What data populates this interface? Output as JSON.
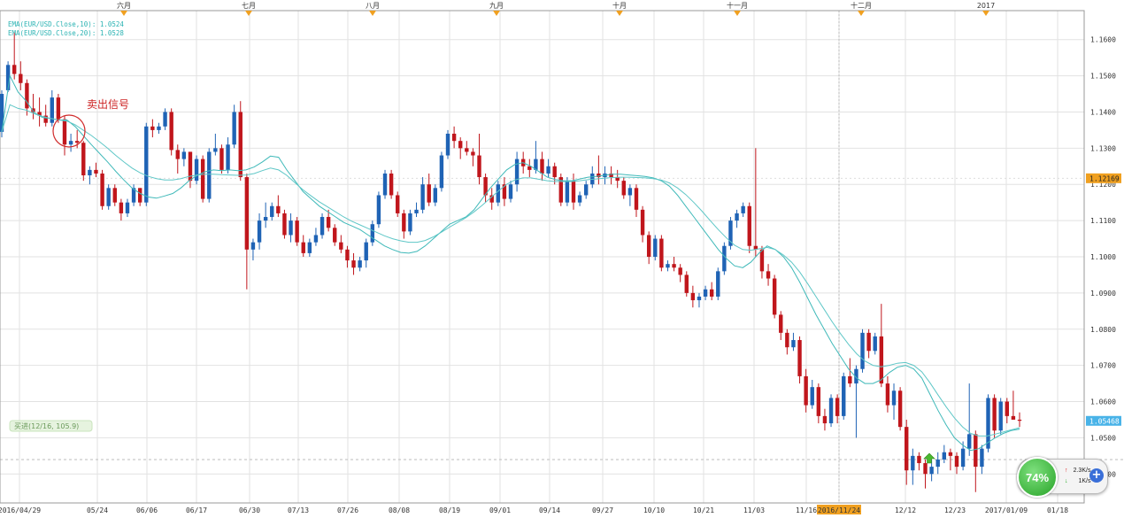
{
  "chart_data": {
    "type": "candlestick",
    "title": "",
    "xlabel": "",
    "ylabel": "",
    "ylim": [
      1.032,
      1.168
    ],
    "y_ticks": [
      "1.1600",
      "1.1500",
      "1.1400",
      "1.1300",
      "1.1200",
      "1.1100",
      "1.1000",
      "1.0900",
      "1.0800",
      "1.0700",
      "1.0600",
      "1.0500",
      "1.0400"
    ],
    "x_ticks": [
      "2016/04/29",
      "05/24",
      "06/06",
      "06/17",
      "06/30",
      "07/13",
      "07/26",
      "08/08",
      "08/19",
      "09/01",
      "09/14",
      "09/27",
      "10/10",
      "10/21",
      "11/03",
      "11/16",
      "2016/11/24",
      "12/12",
      "12/23",
      "2017/01/09",
      "01/18"
    ],
    "month_labels": [
      "六月",
      "七月",
      "八月",
      "九月",
      "十月",
      "十一月",
      "十二月",
      "2017"
    ],
    "legend": [
      "EMA(EUR/USD.Close,10): 1.0524",
      "EMA(EUR/USD.Close,20): 1.0528"
    ],
    "price_tags": {
      "upper": "1.12169",
      "current": "1.05468"
    },
    "annotations": {
      "sell": "卖出信号",
      "buy": "买进(12/16, 105.9)"
    },
    "colors": {
      "up": "#1f63b5",
      "down": "#c0161c",
      "ema10": "#3fb9b9",
      "ema20": "#5fc7c7",
      "grid": "#e2e2e2",
      "month_marker": "#f0a020"
    },
    "ohlc": [
      [
        1.1345,
        1.146,
        1.133,
        1.145
      ],
      [
        1.146,
        1.154,
        1.1455,
        1.153
      ],
      [
        1.153,
        1.162,
        1.149,
        1.1505
      ],
      [
        1.1505,
        1.154,
        1.146,
        1.148
      ],
      [
        1.148,
        1.149,
        1.139,
        1.141
      ],
      [
        1.141,
        1.145,
        1.138,
        1.14
      ],
      [
        1.14,
        1.144,
        1.136,
        1.139
      ],
      [
        1.139,
        1.142,
        1.136,
        1.137
      ],
      [
        1.137,
        1.146,
        1.136,
        1.144
      ],
      [
        1.144,
        1.145,
        1.137,
        1.138
      ],
      [
        1.138,
        1.139,
        1.128,
        1.131
      ],
      [
        1.131,
        1.134,
        1.129,
        1.132
      ],
      [
        1.132,
        1.135,
        1.13,
        1.1315
      ],
      [
        1.1315,
        1.132,
        1.121,
        1.1225
      ],
      [
        1.1225,
        1.125,
        1.12,
        1.124
      ],
      [
        1.124,
        1.126,
        1.122,
        1.123
      ],
      [
        1.123,
        1.124,
        1.113,
        1.114
      ],
      [
        1.114,
        1.12,
        1.113,
        1.119
      ],
      [
        1.119,
        1.12,
        1.114,
        1.115
      ],
      [
        1.115,
        1.116,
        1.11,
        1.112
      ],
      [
        1.112,
        1.116,
        1.111,
        1.115
      ],
      [
        1.115,
        1.12,
        1.114,
        1.119
      ],
      [
        1.119,
        1.119,
        1.114,
        1.115
      ],
      [
        1.115,
        1.137,
        1.114,
        1.136
      ],
      [
        1.136,
        1.138,
        1.133,
        1.135
      ],
      [
        1.135,
        1.137,
        1.134,
        1.136
      ],
      [
        1.136,
        1.141,
        1.135,
        1.14
      ],
      [
        1.14,
        1.141,
        1.128,
        1.1295
      ],
      [
        1.1295,
        1.131,
        1.123,
        1.127
      ],
      [
        1.127,
        1.13,
        1.125,
        1.129
      ],
      [
        1.129,
        1.129,
        1.119,
        1.121
      ],
      [
        1.121,
        1.128,
        1.12,
        1.127
      ],
      [
        1.127,
        1.128,
        1.115,
        1.116
      ],
      [
        1.116,
        1.13,
        1.115,
        1.129
      ],
      [
        1.129,
        1.134,
        1.128,
        1.13
      ],
      [
        1.13,
        1.131,
        1.123,
        1.124
      ],
      [
        1.124,
        1.133,
        1.123,
        1.131
      ],
      [
        1.131,
        1.142,
        1.13,
        1.14
      ],
      [
        1.14,
        1.143,
        1.121,
        1.122
      ],
      [
        1.122,
        1.123,
        1.091,
        1.102
      ],
      [
        1.102,
        1.105,
        1.099,
        1.104
      ],
      [
        1.104,
        1.112,
        1.102,
        1.11
      ],
      [
        1.11,
        1.115,
        1.108,
        1.111
      ],
      [
        1.111,
        1.115,
        1.11,
        1.114
      ],
      [
        1.114,
        1.117,
        1.111,
        1.112
      ],
      [
        1.112,
        1.113,
        1.105,
        1.106
      ],
      [
        1.106,
        1.112,
        1.104,
        1.11
      ],
      [
        1.11,
        1.111,
        1.103,
        1.104
      ],
      [
        1.104,
        1.106,
        1.1,
        1.101
      ],
      [
        1.101,
        1.105,
        1.1,
        1.104
      ],
      [
        1.104,
        1.108,
        1.103,
        1.106
      ],
      [
        1.106,
        1.112,
        1.105,
        1.111
      ],
      [
        1.111,
        1.113,
        1.107,
        1.108
      ],
      [
        1.108,
        1.109,
        1.103,
        1.104
      ],
      [
        1.104,
        1.106,
        1.101,
        1.102
      ],
      [
        1.102,
        1.103,
        1.097,
        1.099
      ],
      [
        1.099,
        1.101,
        1.095,
        1.097
      ],
      [
        1.097,
        1.1,
        1.096,
        1.099
      ],
      [
        1.099,
        1.105,
        1.097,
        1.104
      ],
      [
        1.104,
        1.11,
        1.103,
        1.109
      ],
      [
        1.109,
        1.118,
        1.108,
        1.117
      ],
      [
        1.117,
        1.124,
        1.116,
        1.123
      ],
      [
        1.123,
        1.124,
        1.116,
        1.117
      ],
      [
        1.117,
        1.118,
        1.111,
        1.112
      ],
      [
        1.112,
        1.113,
        1.105,
        1.107
      ],
      [
        1.107,
        1.113,
        1.106,
        1.112
      ],
      [
        1.112,
        1.115,
        1.111,
        1.113
      ],
      [
        1.113,
        1.122,
        1.112,
        1.12
      ],
      [
        1.12,
        1.123,
        1.114,
        1.115
      ],
      [
        1.115,
        1.12,
        1.114,
        1.119
      ],
      [
        1.119,
        1.129,
        1.118,
        1.128
      ],
      [
        1.128,
        1.135,
        1.127,
        1.134
      ],
      [
        1.134,
        1.136,
        1.13,
        1.132
      ],
      [
        1.132,
        1.133,
        1.127,
        1.13
      ],
      [
        1.13,
        1.132,
        1.128,
        1.129
      ],
      [
        1.129,
        1.13,
        1.125,
        1.128
      ],
      [
        1.128,
        1.134,
        1.12,
        1.122
      ],
      [
        1.122,
        1.123,
        1.115,
        1.117
      ],
      [
        1.117,
        1.119,
        1.113,
        1.115
      ],
      [
        1.115,
        1.121,
        1.114,
        1.12
      ],
      [
        1.12,
        1.122,
        1.114,
        1.116
      ],
      [
        1.116,
        1.121,
        1.115,
        1.12
      ],
      [
        1.12,
        1.129,
        1.118,
        1.127
      ],
      [
        1.127,
        1.129,
        1.123,
        1.125
      ],
      [
        1.125,
        1.127,
        1.122,
        1.124
      ],
      [
        1.124,
        1.132,
        1.123,
        1.127
      ],
      [
        1.127,
        1.129,
        1.121,
        1.123
      ],
      [
        1.123,
        1.127,
        1.122,
        1.125
      ],
      [
        1.125,
        1.126,
        1.12,
        1.122
      ],
      [
        1.122,
        1.123,
        1.114,
        1.115
      ],
      [
        1.115,
        1.122,
        1.114,
        1.121
      ],
      [
        1.121,
        1.123,
        1.113,
        1.115
      ],
      [
        1.115,
        1.118,
        1.114,
        1.117
      ],
      [
        1.117,
        1.121,
        1.116,
        1.12
      ],
      [
        1.12,
        1.125,
        1.119,
        1.123
      ],
      [
        1.123,
        1.128,
        1.12,
        1.122
      ],
      [
        1.122,
        1.125,
        1.12,
        1.123
      ],
      [
        1.123,
        1.125,
        1.12,
        1.122
      ],
      [
        1.122,
        1.124,
        1.119,
        1.121
      ],
      [
        1.121,
        1.122,
        1.116,
        1.117
      ],
      [
        1.117,
        1.12,
        1.114,
        1.119
      ],
      [
        1.119,
        1.12,
        1.111,
        1.113
      ],
      [
        1.113,
        1.114,
        1.104,
        1.106
      ],
      [
        1.106,
        1.107,
        1.098,
        1.1
      ],
      [
        1.1,
        1.106,
        1.099,
        1.105
      ],
      [
        1.105,
        1.106,
        1.096,
        1.097
      ],
      [
        1.097,
        1.099,
        1.096,
        1.098
      ],
      [
        1.098,
        1.1,
        1.096,
        1.097
      ],
      [
        1.097,
        1.098,
        1.093,
        1.095
      ],
      [
        1.095,
        1.096,
        1.089,
        1.09
      ],
      [
        1.09,
        1.092,
        1.086,
        1.088
      ],
      [
        1.088,
        1.09,
        1.086,
        1.089
      ],
      [
        1.089,
        1.092,
        1.088,
        1.091
      ],
      [
        1.091,
        1.093,
        1.088,
        1.089
      ],
      [
        1.089,
        1.097,
        1.088,
        1.096
      ],
      [
        1.096,
        1.104,
        1.095,
        1.103
      ],
      [
        1.103,
        1.111,
        1.102,
        1.11
      ],
      [
        1.11,
        1.113,
        1.108,
        1.112
      ],
      [
        1.112,
        1.115,
        1.111,
        1.114
      ],
      [
        1.114,
        1.115,
        1.101,
        1.103
      ],
      [
        1.103,
        1.13,
        1.1,
        1.102
      ],
      [
        1.102,
        1.103,
        1.094,
        1.096
      ],
      [
        1.096,
        1.098,
        1.092,
        1.094
      ],
      [
        1.094,
        1.095,
        1.083,
        1.084
      ],
      [
        1.084,
        1.085,
        1.077,
        1.079
      ],
      [
        1.079,
        1.08,
        1.073,
        1.075
      ],
      [
        1.075,
        1.079,
        1.074,
        1.077
      ],
      [
        1.077,
        1.078,
        1.065,
        1.067
      ],
      [
        1.067,
        1.069,
        1.057,
        1.059
      ],
      [
        1.059,
        1.066,
        1.058,
        1.064
      ],
      [
        1.064,
        1.065,
        1.054,
        1.056
      ],
      [
        1.056,
        1.058,
        1.052,
        1.054
      ],
      [
        1.054,
        1.062,
        1.053,
        1.061
      ],
      [
        1.061,
        1.062,
        1.054,
        1.056
      ],
      [
        1.056,
        1.068,
        1.055,
        1.067
      ],
      [
        1.067,
        1.072,
        1.064,
        1.065
      ],
      [
        1.065,
        1.07,
        1.05,
        1.069
      ],
      [
        1.069,
        1.08,
        1.068,
        1.079
      ],
      [
        1.079,
        1.08,
        1.072,
        1.074
      ],
      [
        1.074,
        1.079,
        1.073,
        1.078
      ],
      [
        1.078,
        1.087,
        1.064,
        1.065
      ],
      [
        1.065,
        1.067,
        1.057,
        1.059
      ],
      [
        1.059,
        1.065,
        1.055,
        1.063
      ],
      [
        1.063,
        1.064,
        1.052,
        1.053
      ],
      [
        1.053,
        1.055,
        1.037,
        1.041
      ],
      [
        1.041,
        1.047,
        1.037,
        1.045
      ],
      [
        1.045,
        1.046,
        1.041,
        1.043
      ],
      [
        1.043,
        1.044,
        1.036,
        1.04
      ],
      [
        1.04,
        1.044,
        1.038,
        1.042
      ],
      [
        1.042,
        1.046,
        1.04,
        1.044
      ],
      [
        1.044,
        1.048,
        1.043,
        1.046
      ],
      [
        1.046,
        1.047,
        1.041,
        1.045
      ],
      [
        1.045,
        1.046,
        1.04,
        1.042
      ],
      [
        1.042,
        1.049,
        1.041,
        1.047
      ],
      [
        1.047,
        1.065,
        1.045,
        1.051
      ],
      [
        1.051,
        1.052,
        1.035,
        1.042
      ],
      [
        1.042,
        1.048,
        1.04,
        1.047
      ],
      [
        1.047,
        1.062,
        1.046,
        1.061
      ],
      [
        1.061,
        1.062,
        1.05,
        1.052
      ],
      [
        1.052,
        1.061,
        1.051,
        1.06
      ],
      [
        1.06,
        1.061,
        1.054,
        1.056
      ],
      [
        1.056,
        1.063,
        1.055,
        1.055
      ],
      [
        1.055,
        1.057,
        1.053,
        1.0547
      ]
    ],
    "series": [
      {
        "name": "EMA(EUR/USD.Close,10)",
        "values": [
          1.1345,
          1.15,
          1.1455,
          1.143,
          1.1398,
          1.1385,
          1.1382,
          1.1378,
          1.1378,
          1.136,
          1.1335,
          1.131,
          1.1286,
          1.1262,
          1.1236,
          1.1212,
          1.119,
          1.1175,
          1.1165,
          1.1162,
          1.1168,
          1.1175,
          1.119,
          1.121,
          1.1225,
          1.1235,
          1.124,
          1.1238,
          1.124,
          1.1238,
          1.124,
          1.1248,
          1.1262,
          1.1278,
          1.1275,
          1.124,
          1.121,
          1.118,
          1.116,
          1.114,
          1.1125,
          1.111,
          1.1095,
          1.1085,
          1.1075,
          1.106,
          1.1045,
          1.103,
          1.102,
          1.1012,
          1.101,
          1.1015,
          1.103,
          1.105,
          1.107,
          1.109,
          1.11,
          1.111,
          1.113,
          1.116,
          1.119,
          1.1215,
          1.124,
          1.1255,
          1.126,
          1.125,
          1.1235,
          1.122,
          1.1213,
          1.121,
          1.121,
          1.1215,
          1.122,
          1.1222,
          1.1225,
          1.1228,
          1.1228,
          1.1226,
          1.1224,
          1.1222,
          1.1218,
          1.121,
          1.1195,
          1.117,
          1.114,
          1.111,
          1.108,
          1.105,
          1.102,
          1.0995,
          1.0975,
          1.097,
          1.0985,
          1.101,
          1.103,
          1.102,
          1.1,
          1.097,
          1.093,
          1.0885,
          1.084,
          1.08,
          1.076,
          1.0725,
          1.069,
          1.0665,
          1.065,
          1.065,
          1.066,
          1.068,
          1.0695,
          1.07,
          1.069,
          1.0665,
          1.062,
          1.0575,
          1.0535,
          1.05,
          1.048,
          1.0465,
          1.047,
          1.0485,
          1.05,
          1.0512,
          1.052,
          1.0524
        ]
      },
      {
        "name": "EMA(EUR/USD.Close,20)",
        "values": [
          1.1345,
          1.142,
          1.141,
          1.1405,
          1.1395,
          1.1388,
          1.1382,
          1.1378,
          1.1375,
          1.1365,
          1.135,
          1.1335,
          1.1318,
          1.13,
          1.128,
          1.1262,
          1.1245,
          1.1232,
          1.1222,
          1.1216,
          1.1212,
          1.1212,
          1.1216,
          1.1222,
          1.1226,
          1.1228,
          1.1228,
          1.1227,
          1.1226,
          1.1225,
          1.1226,
          1.123,
          1.1238,
          1.1245,
          1.124,
          1.1225,
          1.1205,
          1.1185,
          1.1168,
          1.1152,
          1.1138,
          1.1124,
          1.111,
          1.1098,
          1.1088,
          1.1078,
          1.1068,
          1.1058,
          1.105,
          1.1044,
          1.104,
          1.104,
          1.1045,
          1.1055,
          1.1068,
          1.1082,
          1.1095,
          1.1108,
          1.1124,
          1.1142,
          1.1162,
          1.1182,
          1.12,
          1.1212,
          1.1218,
          1.1218,
          1.1214,
          1.121,
          1.1208,
          1.1208,
          1.1208,
          1.121,
          1.1213,
          1.1215,
          1.1217,
          1.1219,
          1.122,
          1.122,
          1.1219,
          1.1218,
          1.1216,
          1.1212,
          1.1204,
          1.119,
          1.1172,
          1.115,
          1.1126,
          1.11,
          1.1075,
          1.1052,
          1.1032,
          1.102,
          1.1018,
          1.1022,
          1.1026,
          1.102,
          1.1005,
          1.0985,
          1.0958,
          1.0925,
          1.089,
          1.0855,
          1.082,
          1.0788,
          1.0758,
          1.0732,
          1.0712,
          1.07,
          1.0696,
          1.07,
          1.0706,
          1.0708,
          1.07,
          1.0682,
          1.0652,
          1.0618,
          1.0585,
          1.0555,
          1.053,
          1.0512,
          1.0505,
          1.0505,
          1.051,
          1.0516,
          1.0522,
          1.0528
        ]
      }
    ]
  },
  "widget": {
    "percent": "74%",
    "up_speed": "2.3K/s",
    "down_speed": "1K/s",
    "up_arrow": "↑",
    "down_arrow": "↓",
    "plus": "+"
  }
}
